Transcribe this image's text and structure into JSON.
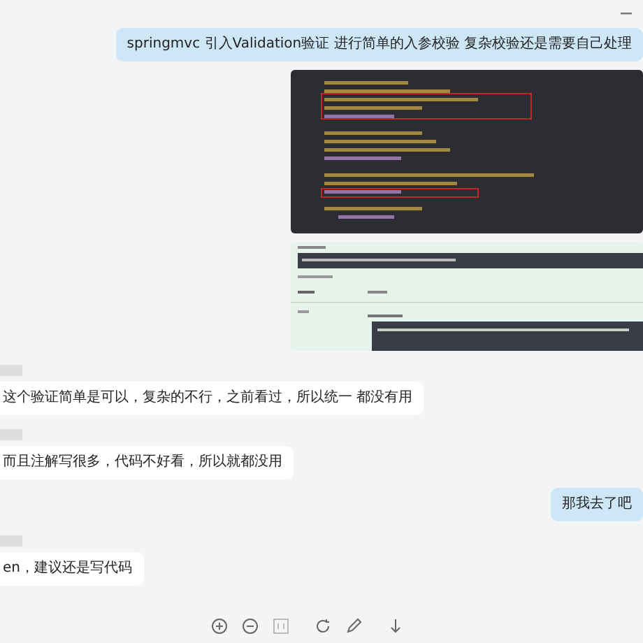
{
  "messages": [
    {
      "kind": "sent",
      "text": "springmvc  引入Validation验证 进行简单的入参校验   复杂校验还是需要自己处理"
    },
    {
      "kind": "sent-code-image"
    },
    {
      "kind": "sent-response-image"
    },
    {
      "kind": "received",
      "text": "这个验证简单是可以，复杂的不行，之前看过，所以统一 都没有用"
    },
    {
      "kind": "received",
      "text": "而且注解写很多，代码不好看，所以就都没用"
    },
    {
      "kind": "sent",
      "text": "那我去了吧"
    },
    {
      "kind": "received",
      "text": "en，建议还是写代码"
    }
  ],
  "toolbar": [
    {
      "kind": "zoom-in"
    },
    {
      "kind": "zoom-out"
    },
    {
      "kind": "fit"
    },
    {
      "kind": "rotate"
    },
    {
      "kind": "pen"
    },
    {
      "kind": "download"
    }
  ]
}
